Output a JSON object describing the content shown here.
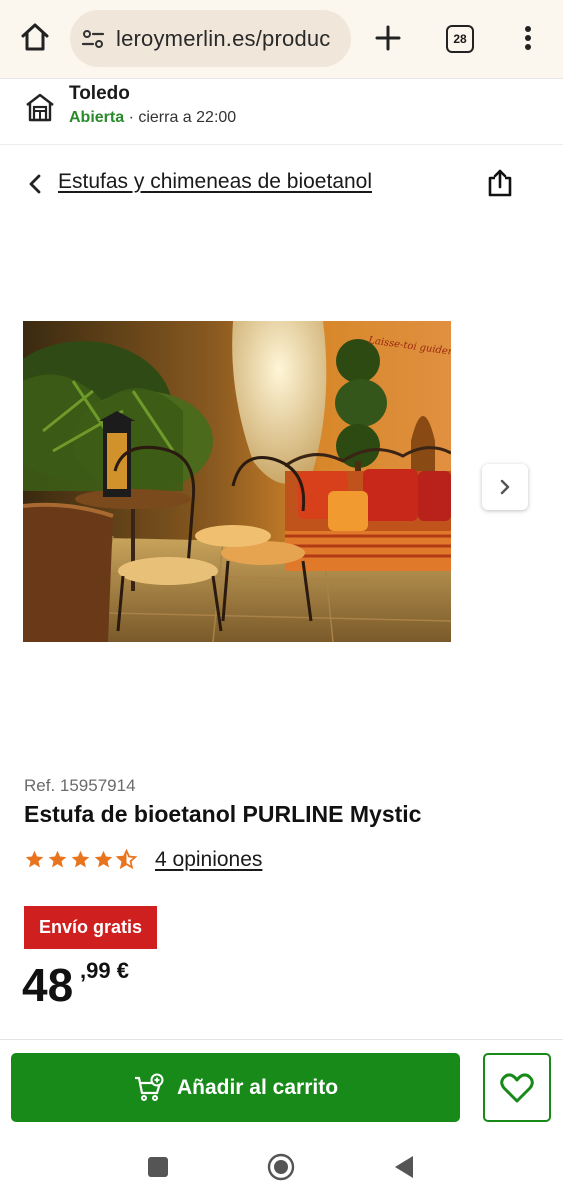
{
  "browser": {
    "url": "leroymerlin.es/produc",
    "tab_count": "28",
    "icons": [
      "home-icon",
      "site-settings-icon",
      "new-tab-plus-icon",
      "tabs-count-icon",
      "more-menu-icon"
    ]
  },
  "store": {
    "name": "Toledo",
    "status_open": "Abierta",
    "status_rest": " · cierra a 22:00"
  },
  "breadcrumb": {
    "label": "Estufas y chimeneas de bioetanol"
  },
  "product": {
    "ref": "Ref. 15957914",
    "title": "Estufa de bioetanol PURLINE Mystic",
    "rating": 4.5,
    "rating_max": 5,
    "reviews_label": "4 opiniones",
    "badge": "Envío gratis",
    "price_int": "48",
    "price_dec": ",99 €",
    "image_text": "Laisse-toi guider par la lumière du soir"
  },
  "actions": {
    "add_to_cart": "Añadir al carrito"
  },
  "colors": {
    "brand_green": "#188a1a",
    "open_green": "#2b8a2b",
    "badge_red": "#d01f1f",
    "star_orange": "#e8741e"
  }
}
